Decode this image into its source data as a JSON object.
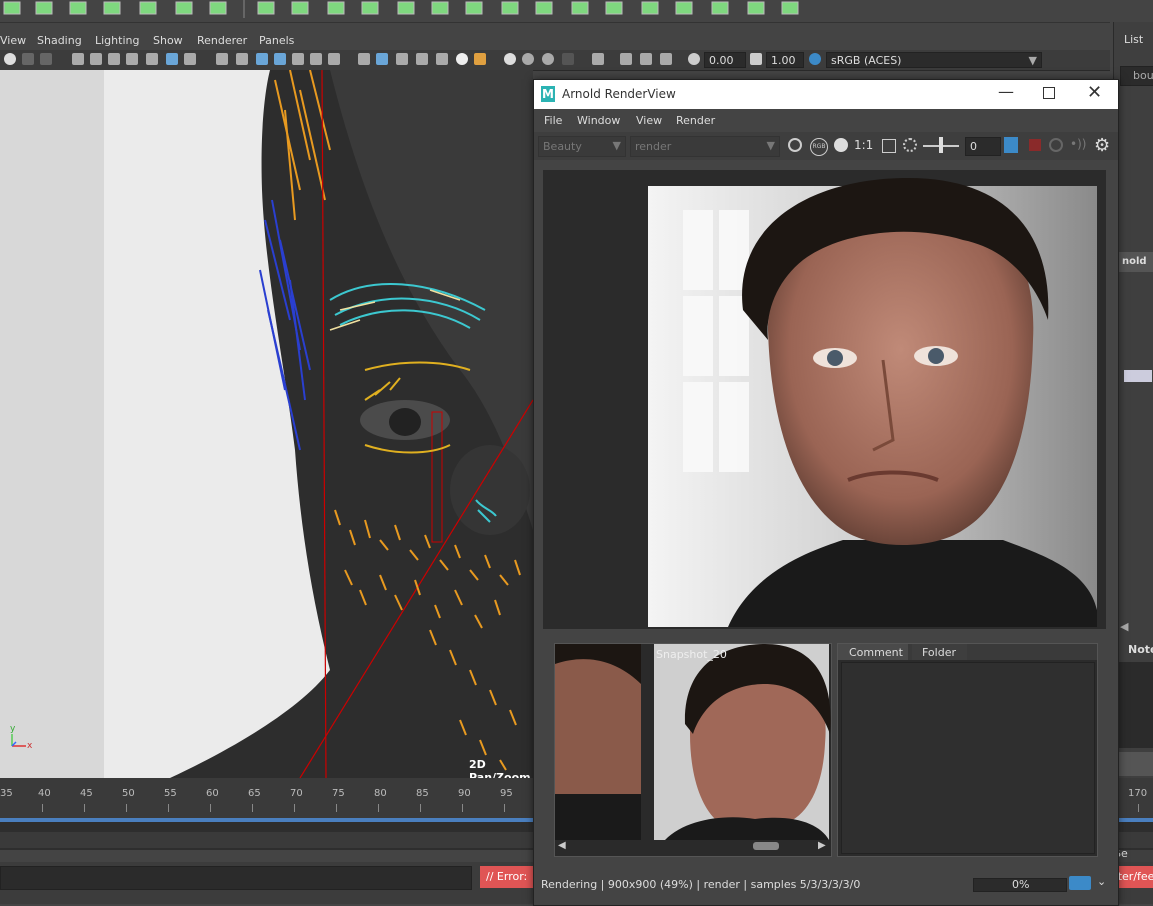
{
  "viewport": {
    "menu": [
      "View",
      "Shading",
      "Lighting",
      "Show",
      "Renderer",
      "Panels"
    ],
    "exposure_value": "0.00",
    "gamma_value": "1.00",
    "colorspace": "sRGB (ACES)",
    "hud_label": "2D Pan/Zoom",
    "axis_y": "y",
    "axis_x": "x"
  },
  "right_panel": {
    "list_label": "List",
    "field_1": "bou",
    "section": "nold",
    "notes_label": "Note"
  },
  "timeline": {
    "ticks": [
      "35",
      "40",
      "45",
      "50",
      "55",
      "60",
      "65",
      "70",
      "75",
      "80",
      "85",
      "90",
      "95"
    ],
    "end_tick": "170"
  },
  "command_bar": {
    "error_text": "// Error: ",
    "right_text": "ster/fee",
    "right_label": "acter Se"
  },
  "arnold": {
    "title": "Arnold RenderView",
    "menu": [
      "File",
      "Window",
      "View",
      "Render"
    ],
    "aov_select": "Beauty",
    "camera_select": "render",
    "ratio_label": "1:1",
    "exposure_value": "0",
    "snapshot_label": "Snapshot_20",
    "comment_tab": "Comment",
    "folder_tab": "Folder",
    "status": "Rendering | 900x900 (49%) | render | samples 5/3/3/3/3/0",
    "progress_label": "0%",
    "progress": 0
  }
}
